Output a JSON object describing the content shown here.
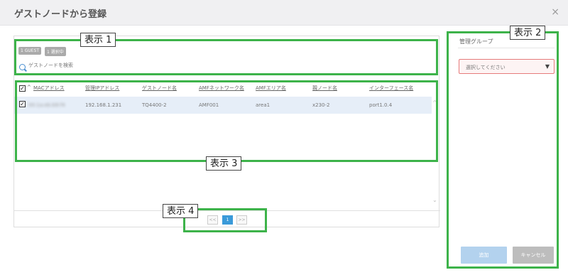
{
  "dialog": {
    "title": "ゲストノードから登録",
    "close_icon": "×"
  },
  "filter": {
    "badge_count": "1 GUEST",
    "badge_selected": "1 選択中",
    "search_placeholder": "ゲストノードを検索"
  },
  "table": {
    "headers": [
      "MACアドレス",
      "管理IPアドレス",
      "ゲストノード名",
      "AMFネットワーク名",
      "AMFエリア名",
      "親ノード名",
      "インターフェース名"
    ],
    "rows": [
      {
        "mac": "00:1a:eb:b9:f4",
        "ip": "192.168.1.231",
        "guest_name": "TQ4400-2",
        "amf_network": "AMF001",
        "amf_area": "area1",
        "parent": "x230-2",
        "interface": "port1.0.4",
        "checked": true
      }
    ]
  },
  "pagination": {
    "prev": "<<",
    "current": "1",
    "next": ">>"
  },
  "right_panel": {
    "group_label": "管理グループ",
    "select_placeholder": "選択してください",
    "add_button": "追加",
    "cancel_button": "キャンセル"
  },
  "callouts": [
    "表示 1",
    "表示 2",
    "表示 3",
    "表示 4"
  ],
  "colors": {
    "callout": "#3db34a",
    "active_page": "#3a9ad9",
    "select_border": "#e67b7b",
    "selected_row": "#e6eef8"
  }
}
